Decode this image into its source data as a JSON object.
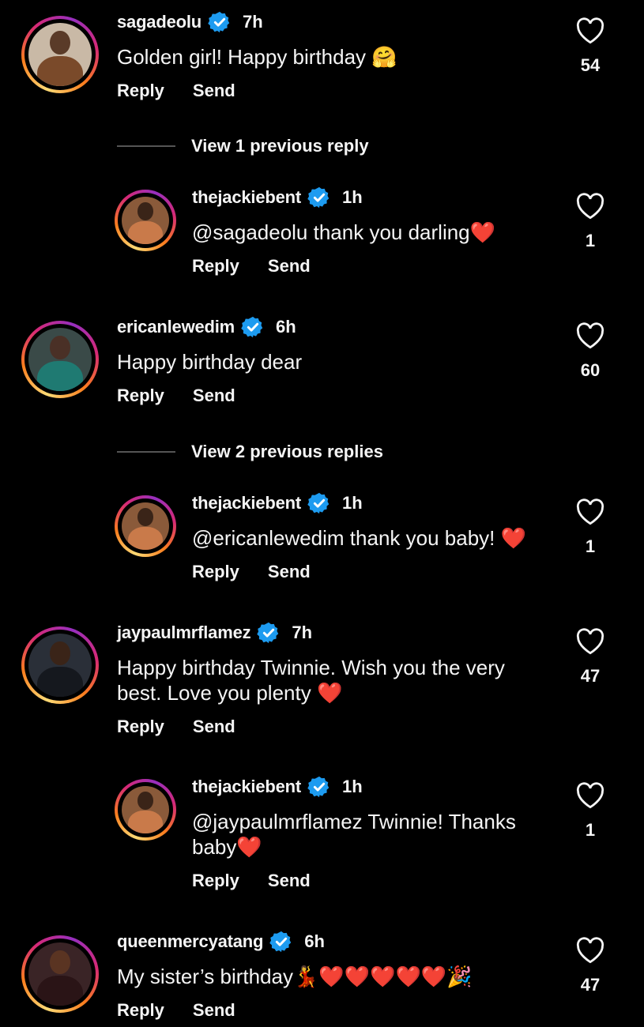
{
  "colors": {
    "background": "#000000",
    "text": "#f5f5f5",
    "verified": "#1d9bf0",
    "heart_emoji": "#e0245e"
  },
  "actions": {
    "reply": "Reply",
    "send": "Send"
  },
  "comments": [
    {
      "username": "sagadeolu",
      "time": "7h",
      "text": "Golden girl! Happy birthday ",
      "emoji": "🤗",
      "likes": "54"
    },
    {
      "view_replies": "View 1 previous reply"
    },
    {
      "username": "thejackiebent",
      "time": "1h",
      "text": "@sagadeolu thank you darling",
      "emoji": "❤️",
      "likes": "1"
    },
    {
      "username": "ericanlewedim",
      "time": "6h",
      "text": "Happy birthday dear",
      "likes": "60"
    },
    {
      "view_replies": "View 2 previous replies"
    },
    {
      "username": "thejackiebent",
      "time": "1h",
      "text": "@ericanlewedim thank you baby! ",
      "emoji": "❤️",
      "likes": "1"
    },
    {
      "username": "jaypaulmrflamez",
      "time": "7h",
      "text": "Happy birthday Twinnie. Wish you the very best. Love you plenty ",
      "emoji": "❤️",
      "likes": "47"
    },
    {
      "username": "thejackiebent",
      "time": "1h",
      "text": "@jaypaulmrflamez Twinnie! Thanks baby",
      "emoji": "❤️",
      "likes": "1"
    },
    {
      "username": "queenmercyatang",
      "time": "6h",
      "text": "My sister’s birthday",
      "emoji": "💃❤️❤️❤️❤️❤️🎉",
      "likes": "47"
    }
  ]
}
